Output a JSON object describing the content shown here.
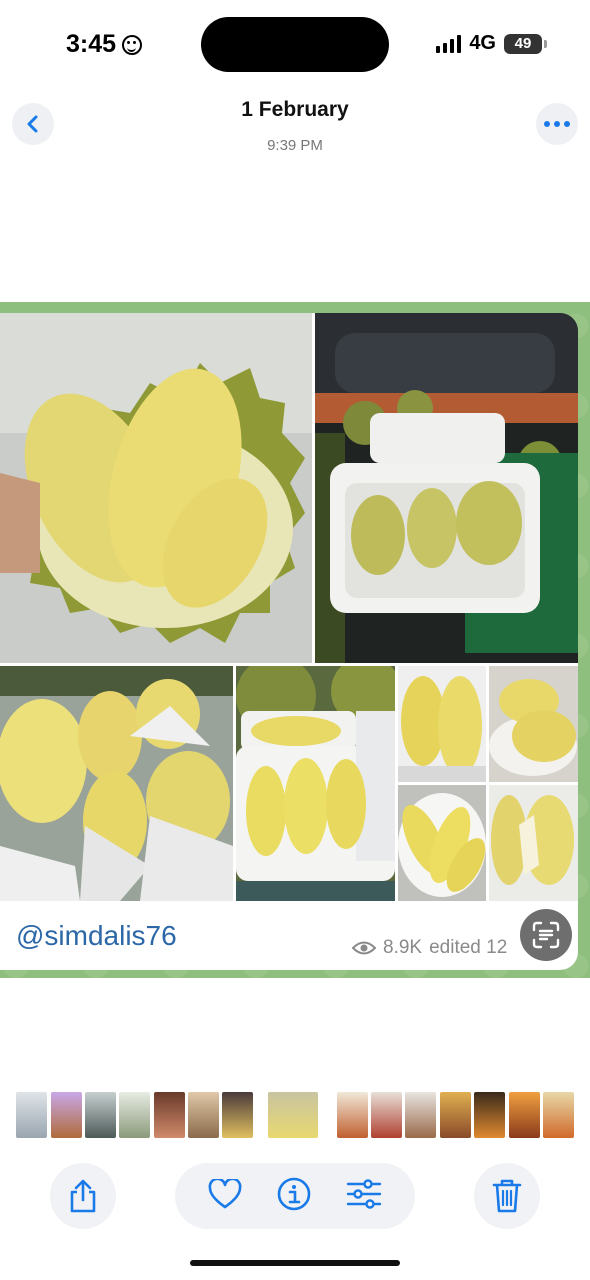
{
  "status_bar": {
    "time": "3:45",
    "network": "4G",
    "battery": "49"
  },
  "header": {
    "title": "1 February",
    "subtitle": "9:39 PM"
  },
  "message": {
    "mention": "@simdalis76",
    "views": "8.9K",
    "edited": "edited 12"
  },
  "thumbnails_count": 16,
  "colors": {
    "accent": "#1a7ae8",
    "mention": "#2c68a8",
    "chat_background": "#8fbf7e"
  },
  "icons": {
    "back": "chevron-left-icon",
    "more": "ellipsis-icon",
    "views": "eye-icon",
    "scan": "text-scan-icon",
    "share": "share-icon",
    "like": "heart-icon",
    "info": "info-icon",
    "adjust": "sliders-icon",
    "delete": "trash-icon"
  }
}
